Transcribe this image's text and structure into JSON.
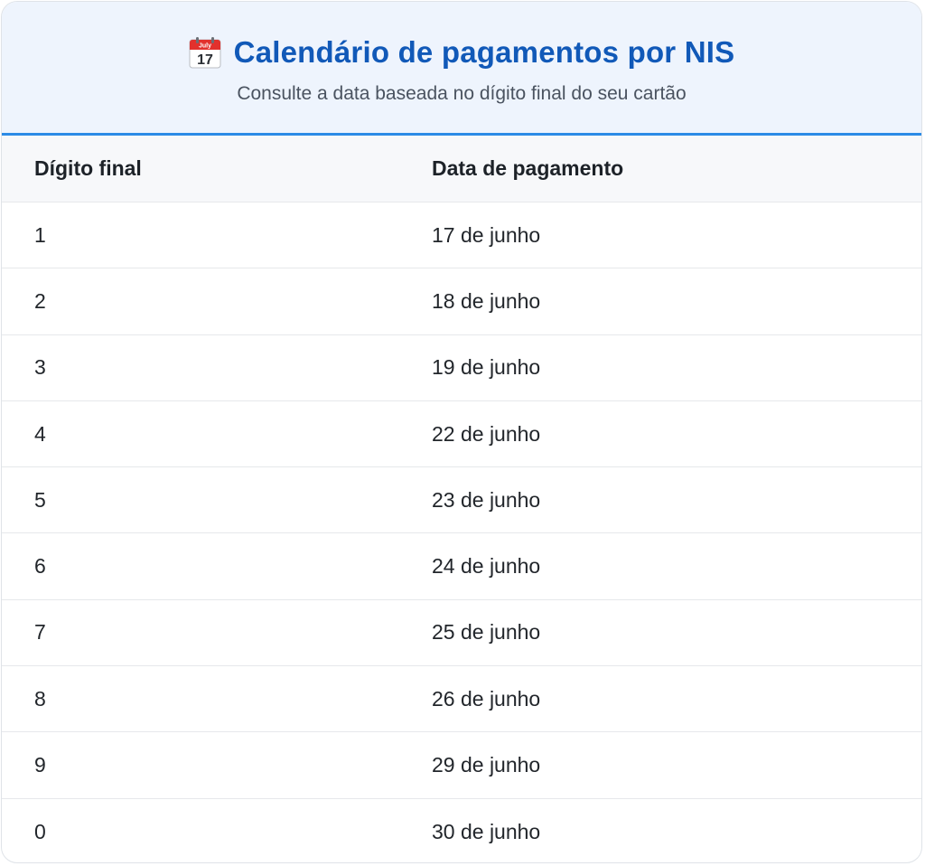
{
  "header": {
    "icon": "calendar-icon",
    "icon_month": "July",
    "icon_day": "17",
    "title": "Calendário de pagamentos por NIS",
    "subtitle": "Consulte a data baseada no dígito final do seu cartão"
  },
  "table": {
    "columns": [
      "Dígito final",
      "Data de pagamento"
    ],
    "rows": [
      {
        "digit": "1",
        "date": "17 de junho"
      },
      {
        "digit": "2",
        "date": "18 de junho"
      },
      {
        "digit": "3",
        "date": "19 de junho"
      },
      {
        "digit": "4",
        "date": "22 de junho"
      },
      {
        "digit": "5",
        "date": "23 de junho"
      },
      {
        "digit": "6",
        "date": "24 de junho"
      },
      {
        "digit": "7",
        "date": "25 de junho"
      },
      {
        "digit": "8",
        "date": "26 de junho"
      },
      {
        "digit": "9",
        "date": "29 de junho"
      },
      {
        "digit": "0",
        "date": "30 de junho"
      }
    ]
  },
  "colors": {
    "title": "#1159b8",
    "accent_border": "#2b8be6",
    "header_bg": "#eef4fd"
  }
}
